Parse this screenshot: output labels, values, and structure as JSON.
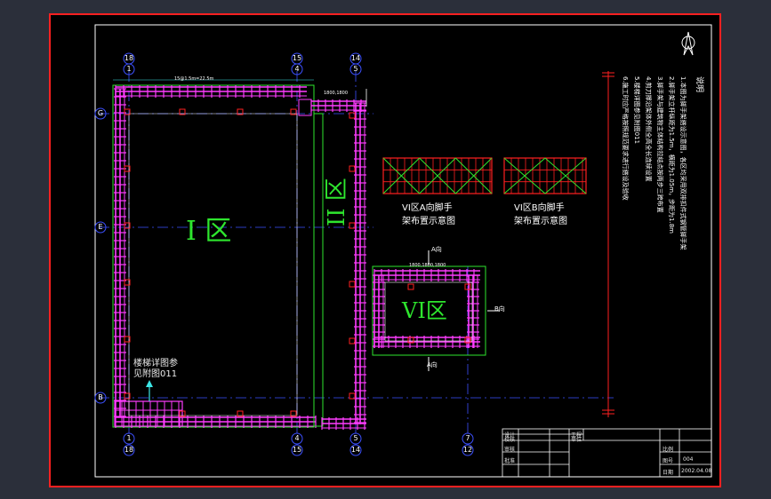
{
  "zones": {
    "zone1": "I 区",
    "zone2": "II 区",
    "zone6": "VI区"
  },
  "axis_top": [
    "18",
    "1",
    "15",
    "4",
    "14",
    "5"
  ],
  "axis_bottom": [
    "1",
    "18",
    "4",
    "15",
    "5",
    "14",
    "7",
    "12"
  ],
  "axis_left": [
    "G",
    "E",
    "B"
  ],
  "annotations": {
    "stair_note_1": "楼梯详图参",
    "stair_note_2": "见附图011",
    "dir_a_top": "A向",
    "dir_a_bottom": "A向",
    "dir_b": "B向",
    "dim_top": "15@1.5m=22.5m",
    "dim_top2": "1800,1800",
    "dim_zone6": "1800,1800,1800"
  },
  "detail_a": {
    "line1": "VI区A向脚手",
    "line2": "架布置示意图"
  },
  "detail_b": {
    "line1": "VI区B向脚手",
    "line2": "架布置示意图"
  },
  "notes_title": "说明",
  "notes": [
    "1.本图为脚手架搭设示意图，各区均采用双排扣件式钢管脚手架",
    "2.脚手架立杆纵距为1.5m，横距为1.05m，步距为1.8m",
    "3.脚手架与建筑物主体结构拉结点按两步三跨布置",
    "4.剪刀撑沿架体外侧全高全长连续设置",
    "5.楼梯详图参见附图011",
    "6.施工时应严格按照规范要求进行搭设及验收"
  ],
  "title_block": {
    "design": "设计",
    "check": "校核",
    "approve": "审核",
    "approve2": "批准",
    "project": "工程",
    "unit": "单位",
    "drawing_no_label": "图号",
    "drawing_no": "004",
    "scale_label": "比例",
    "date_label": "日期",
    "date": "2002.04.08"
  },
  "colors": {
    "background": "#000000",
    "outer": "#2b2f3a",
    "frame": "#ff2020",
    "border": "#ffffff",
    "pipe": "#ff3cff",
    "brace": "#2ee62e",
    "axis": "#3c50ff",
    "text": "#ffffff",
    "dim": "#3ce6e6",
    "column": "#ff2020"
  }
}
